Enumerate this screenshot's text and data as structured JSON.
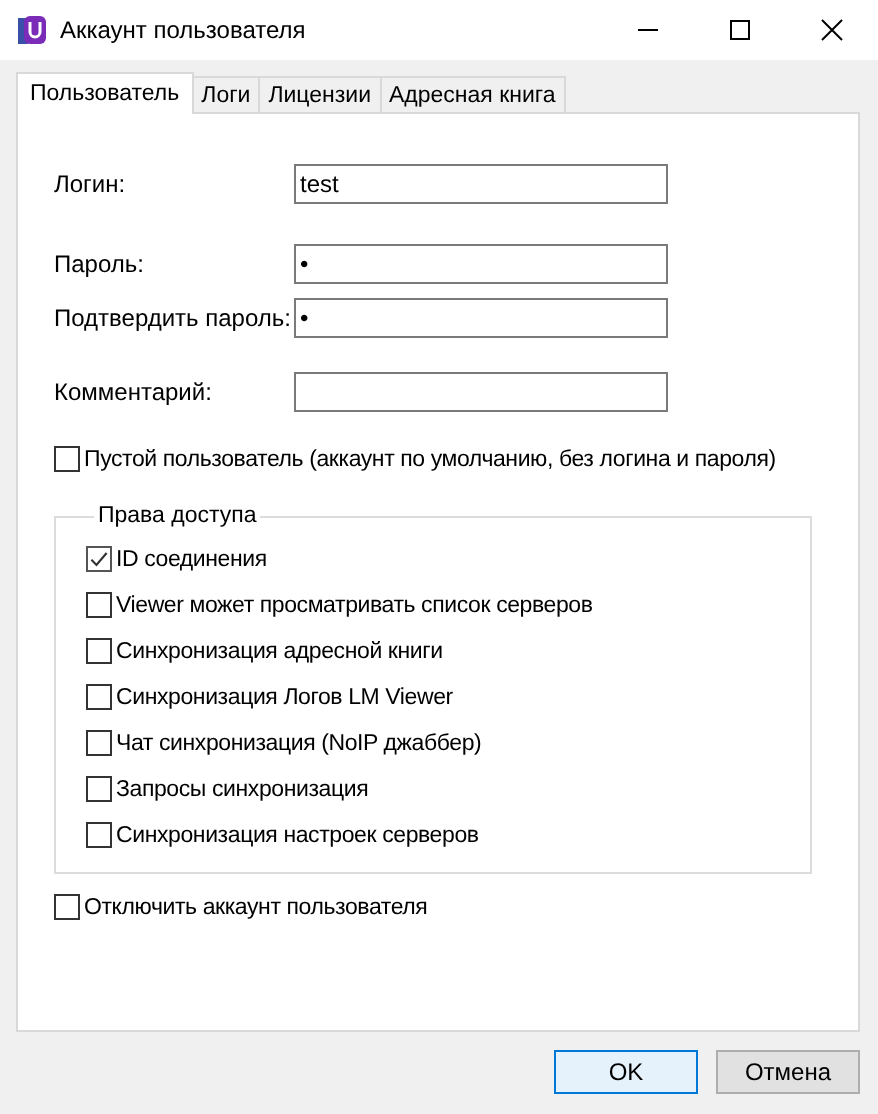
{
  "window": {
    "title": "Аккаунт пользователя"
  },
  "tabs": [
    {
      "label": "Пользователь",
      "selected": true
    },
    {
      "label": "Логи",
      "selected": false
    },
    {
      "label": "Лицензии",
      "selected": false
    },
    {
      "label": "Адресная книга",
      "selected": false
    }
  ],
  "fields": [
    {
      "label": "Логин:",
      "value": "test"
    },
    {
      "label": "Пароль:",
      "value": "•"
    },
    {
      "label": "Подтвердить пароль:",
      "value": "•"
    },
    {
      "label": "Комментарий:"
    }
  ],
  "empty_user": {
    "label": "Пустой пользователь (аккаунт по умолчанию, без логина и пароля)",
    "checked": false
  },
  "permissions": {
    "title": "Права доступа",
    "items": [
      {
        "label": "ID соединения",
        "checked": true
      },
      {
        "label": "Viewer может просматривать список серверов",
        "checked": false
      },
      {
        "label": "Синхронизация адресной книги",
        "checked": false
      },
      {
        "label": "Синхронизация Логов LM Viewer",
        "checked": false
      },
      {
        "label": "Чат синхронизация (NoIP джаббер)",
        "checked": false
      },
      {
        "label": "Запросы синхронизация",
        "checked": false
      },
      {
        "label": "Синхронизация настроек серверов",
        "checked": false
      }
    ]
  },
  "disable_account": {
    "label": "Отключить аккаунт пользователя",
    "checked": false
  },
  "buttons": [
    {
      "label": "OK",
      "kind": "default"
    },
    {
      "label": "Отмена",
      "kind": "normal"
    }
  ]
}
